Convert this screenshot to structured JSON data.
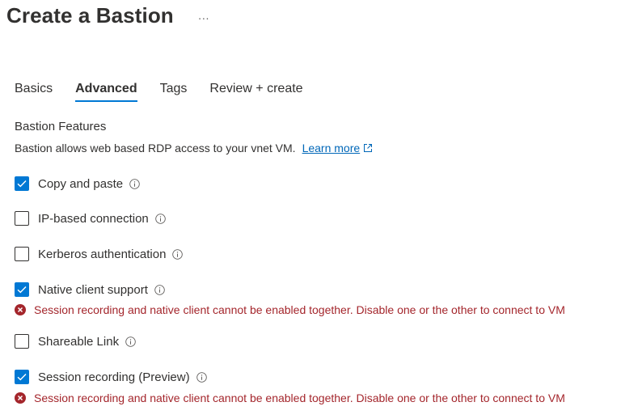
{
  "page": {
    "title": "Create a Bastion",
    "more": "···"
  },
  "tabs": [
    {
      "label": "Basics",
      "active": false
    },
    {
      "label": "Advanced",
      "active": true
    },
    {
      "label": "Tags",
      "active": false
    },
    {
      "label": "Review + create",
      "active": false
    }
  ],
  "section": {
    "title": "Bastion Features",
    "description": "Bastion allows web based RDP access to your vnet VM.",
    "learn_more": "Learn more"
  },
  "options": [
    {
      "label": "Copy and paste",
      "checked": true
    },
    {
      "label": "IP-based connection",
      "checked": false
    },
    {
      "label": "Kerberos authentication",
      "checked": false
    },
    {
      "label": "Native client support",
      "checked": true
    },
    {
      "label": "Shareable Link",
      "checked": false
    },
    {
      "label": "Session recording (Preview)",
      "checked": true
    }
  ],
  "errors": {
    "native_client": "Session recording and native client cannot be enabled together. Disable one or the other to connect to VM",
    "session_recording": "Session recording and native client cannot be enabled together. Disable one or the other to connect to VM"
  },
  "colors": {
    "accent": "#0078d4",
    "error": "#a4262c",
    "link": "#0067b8"
  }
}
